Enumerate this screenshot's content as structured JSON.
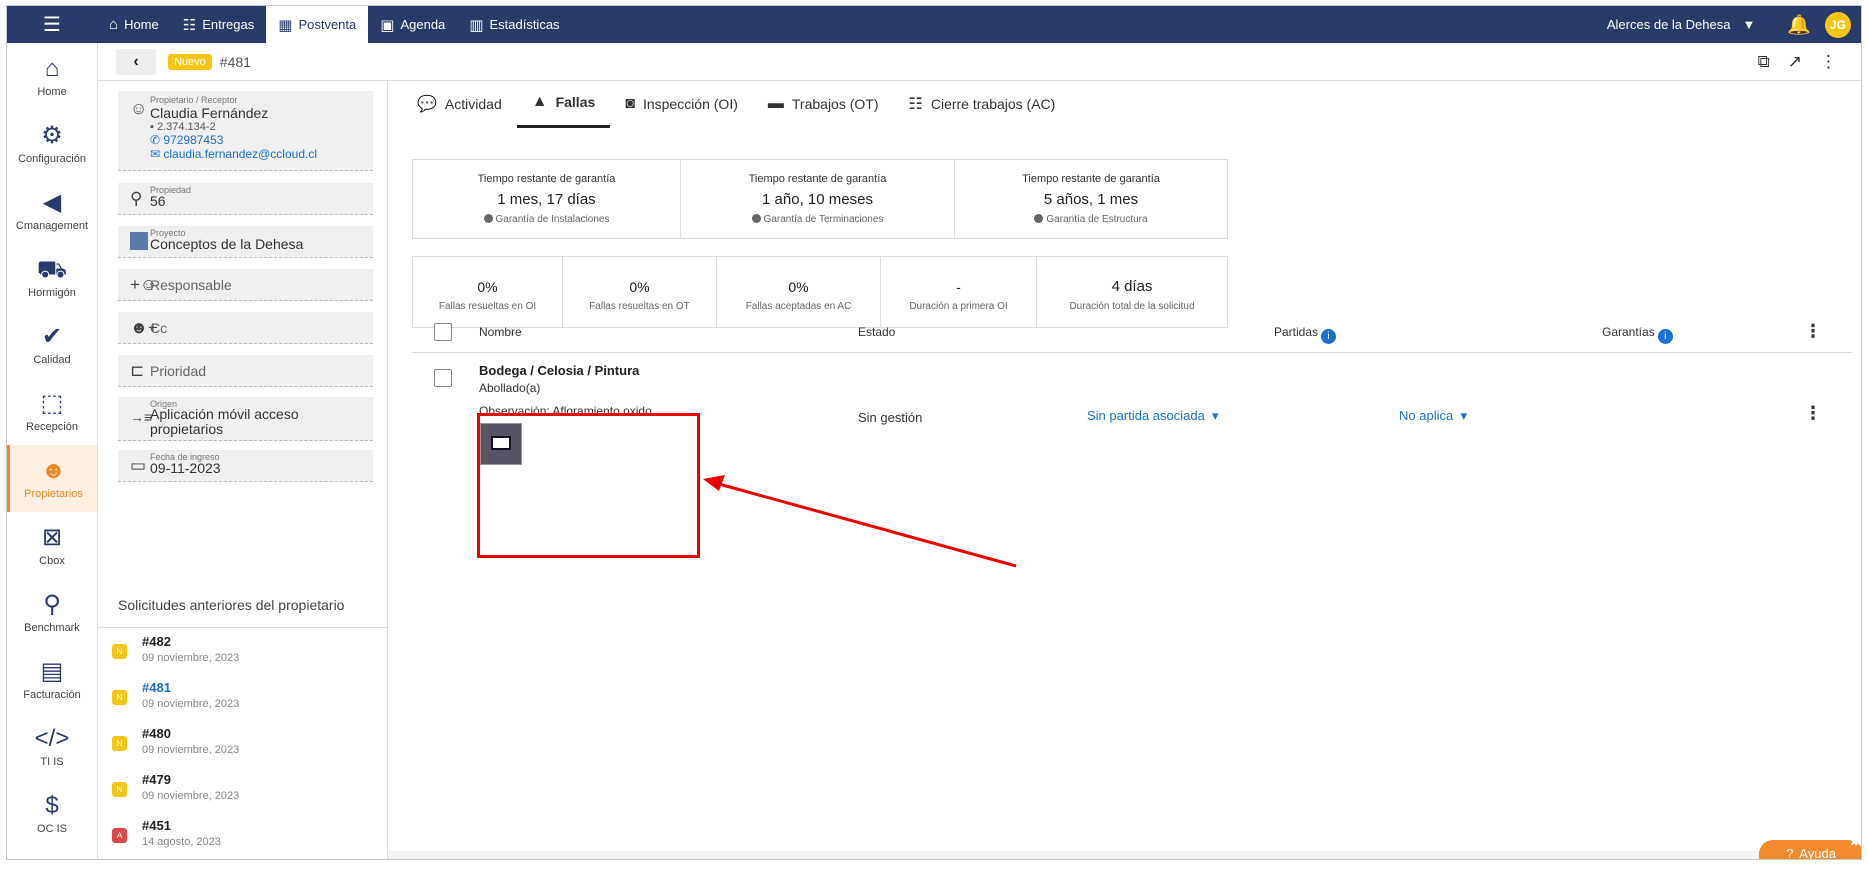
{
  "topbar": {
    "nav": [
      {
        "label": "Home",
        "icon": "home-icon"
      },
      {
        "label": "Entregas",
        "icon": "list-icon"
      },
      {
        "label": "Postventa",
        "icon": "table-icon"
      },
      {
        "label": "Agenda",
        "icon": "calendar-icon"
      },
      {
        "label": "Estadísticas",
        "icon": "chart-icon"
      }
    ],
    "company": "Alerces de la Dehesa",
    "avatar": "JG"
  },
  "rail": [
    {
      "label": "Home",
      "icon": "home-icon"
    },
    {
      "label": "Configuración",
      "icon": "settings-icon"
    },
    {
      "label": "Cmanagement",
      "icon": "cmanagement-icon"
    },
    {
      "label": "Hormigón",
      "icon": "wheelbarrow-icon"
    },
    {
      "label": "Calidad",
      "icon": "quality-icon"
    },
    {
      "label": "Recepción",
      "icon": "reception-icon"
    },
    {
      "label": "Propietarios",
      "icon": "owners-icon"
    },
    {
      "label": "Cbox",
      "icon": "cbox-icon"
    },
    {
      "label": "Benchmark",
      "icon": "benchmark-icon"
    },
    {
      "label": "Facturación",
      "icon": "billing-icon"
    },
    {
      "label": "TI IS",
      "icon": "code-icon"
    },
    {
      "label": "OC IS",
      "icon": "dollar-icon"
    }
  ],
  "header": {
    "badge": "Nuevo",
    "request_number": "#481"
  },
  "owner": {
    "label": "Propietario / Receptor",
    "name": "Claudia Fernández",
    "rut": "2.374.134-2",
    "phone": "972987453",
    "email": "claudia.fernandez@ccloud.cl"
  },
  "property": {
    "label": "Propiedad",
    "value": "56"
  },
  "project": {
    "label": "Proyecto",
    "value": "Conceptos de la Dehesa"
  },
  "responsible": {
    "label": "Responsable"
  },
  "cc": {
    "label": "Cc"
  },
  "priority": {
    "label": "Prioridad"
  },
  "origin": {
    "label": "Origen",
    "value": "Aplicación móvil acceso propietarios"
  },
  "entry_date": {
    "label": "Fecha de ingreso",
    "value": "09-11-2023"
  },
  "previous": {
    "title": "Solicitudes anteriores del propietario",
    "items": [
      {
        "badge": "N",
        "number": "#482",
        "date": "09 noviembre, 2023",
        "color": "#f5c518"
      },
      {
        "badge": "N",
        "number": "#481",
        "date": "09 noviembre, 2023",
        "color": "#f5c518"
      },
      {
        "badge": "N",
        "number": "#480",
        "date": "09 noviembre, 2023",
        "color": "#f5c518"
      },
      {
        "badge": "N",
        "number": "#479",
        "date": "09 noviembre, 2023",
        "color": "#f5c518"
      },
      {
        "badge": "A",
        "number": "#451",
        "date": "14 agosto, 2023",
        "color": "#e04848"
      }
    ]
  },
  "tabs": [
    {
      "label": "Actividad",
      "icon": "chat-icon"
    },
    {
      "label": "Fallas",
      "icon": "warning-icon"
    },
    {
      "label": "Inspección (OI)",
      "icon": "search-icon"
    },
    {
      "label": "Trabajos (OT)",
      "icon": "briefcase-icon"
    },
    {
      "label": "Cierre trabajos (AC)",
      "icon": "checklist-icon"
    }
  ],
  "warranty": [
    {
      "label": "Tiempo restante de garantía",
      "value": "1 mes, 17 días",
      "sub": "Garantía de Instalaciones"
    },
    {
      "label": "Tiempo restante de garantía",
      "value": "1 año, 10 meses",
      "sub": "Garantía de Terminaciones"
    },
    {
      "label": "Tiempo restante de garantía",
      "value": "5 años, 1 mes",
      "sub": "Garantía de Estructura"
    }
  ],
  "metrics": [
    {
      "value": "0%",
      "label": "Fallas resueltas en OI"
    },
    {
      "value": "0%",
      "label": "Fallas resueltas en OT"
    },
    {
      "value": "0%",
      "label": "Fallas aceptadas en AC"
    },
    {
      "value": "-",
      "label": "Duración a primera OI"
    },
    {
      "value": "4 días",
      "label": "Duración total de la solicitud"
    }
  ],
  "table": {
    "headers": {
      "name": "Nombre",
      "state": "Estado",
      "items": "Partidas",
      "warranties": "Garantías"
    },
    "rows": [
      {
        "title": "Bodega / Celosia / Pintura",
        "type": "Abollado(a)",
        "observation": "Observación: Afloramiento oxido.",
        "state": "Sin gestión",
        "item": "Sin partida asociada",
        "warranty": "No aplica"
      }
    ]
  },
  "help": {
    "label": "Ayuda"
  },
  "colors": {
    "topbar": "#2a3a6b",
    "accent": "#e88a2a",
    "link": "#1a6fd1",
    "highlight": "#e00000"
  }
}
